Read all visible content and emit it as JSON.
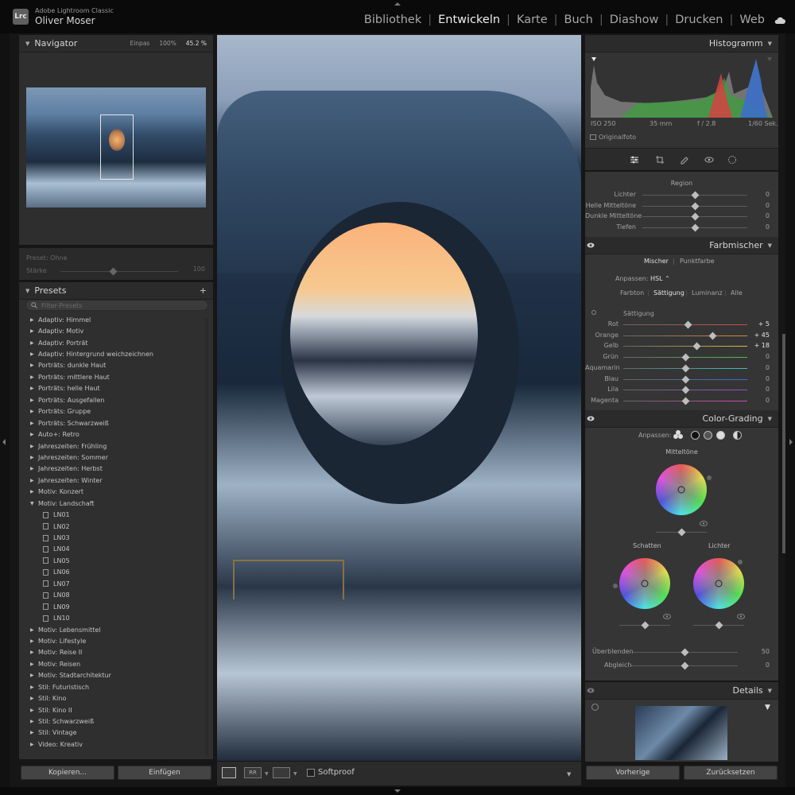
{
  "window": {
    "app_name": "Adobe Lightroom Classic",
    "user": "Oliver Moser",
    "logo": "Lrc"
  },
  "modules": [
    {
      "label": "Bibliothek",
      "active": false
    },
    {
      "label": "Entwickeln",
      "active": true
    },
    {
      "label": "Karte",
      "active": false
    },
    {
      "label": "Buch",
      "active": false
    },
    {
      "label": "Diashow",
      "active": false
    },
    {
      "label": "Drucken",
      "active": false
    },
    {
      "label": "Web",
      "active": false
    }
  ],
  "navigator": {
    "title": "Navigator",
    "opt_fit": "Einpas",
    "opt_100": "100%",
    "opt_zoom": "45.2 %"
  },
  "preset_amount": {
    "preset_label": "Preset: Ohne",
    "amount_label": "Stärke",
    "amount_value": "100"
  },
  "presets": {
    "title": "Presets",
    "filter_placeholder": "Filter-Presets",
    "groups": [
      "Adaptiv: Himmel",
      "Adaptiv: Motiv",
      "Adaptiv: Porträt",
      "Adaptiv: Hintergrund weichzeichnen",
      "Porträts: dunkle Haut",
      "Porträts: mittlere Haut",
      "Porträts: helle Haut",
      "Porträts: Ausgefallen",
      "Porträts: Gruppe",
      "Porträts: Schwarzweiß",
      "Auto+: Retro",
      "Jahreszeiten: Frühling",
      "Jahreszeiten: Sommer",
      "Jahreszeiten: Herbst",
      "Jahreszeiten: Winter",
      "Motiv: Konzert",
      "Motiv: Landschaft"
    ],
    "expanded_items": [
      "LN01",
      "LN02",
      "LN03",
      "LN04",
      "LN05",
      "LN06",
      "LN07",
      "LN08",
      "LN09",
      "LN10"
    ],
    "groups_after": [
      "Motiv: Lebensmittel",
      "Motiv: Lifestyle",
      "Motiv: Reise II",
      "Motiv: Reisen",
      "Motiv: Stadtarchitektur",
      "Stil: Futuristisch",
      "Stil: Kino",
      "Stil: Kino II",
      "Stil: Schwarzweiß",
      "Stil: Vintage",
      "Video: Kreativ"
    ]
  },
  "left_buttons": {
    "copy": "Kopieren...",
    "paste": "Einfügen"
  },
  "toolbar": {
    "softproof": "Softproof"
  },
  "histogram": {
    "title": "Histogramm",
    "iso": "ISO 250",
    "focal": "35 mm",
    "aperture": "f / 2.8",
    "shutter": "1/60 Sek.",
    "original_photo": "Originalfoto"
  },
  "region": {
    "title": "Region",
    "rows": [
      {
        "label": "Lichter",
        "value": "0",
        "pos": 0.5
      },
      {
        "label": "Helle Mitteltöne",
        "value": "0",
        "pos": 0.5
      },
      {
        "label": "Dunkle Mitteltöne",
        "value": "0",
        "pos": 0.5
      },
      {
        "label": "Tiefen",
        "value": "0",
        "pos": 0.5
      }
    ]
  },
  "mixer": {
    "title": "Farbmischer",
    "tab1": "Mischer",
    "tab2": "Punktfarbe",
    "adjust_label": "Anpassen:",
    "adjust_value": "HSL",
    "modes": [
      "Farbton",
      "Sättigung",
      "Luminanz",
      "Alle"
    ],
    "active_mode": "Sättigung",
    "section": "Sättigung",
    "rows": [
      {
        "label": "Rot",
        "value": "+ 5",
        "pos": 0.52,
        "color": "#d24a4a"
      },
      {
        "label": "Orange",
        "value": "+ 45",
        "pos": 0.72,
        "color": "#d88b3a"
      },
      {
        "label": "Gelb",
        "value": "+ 18",
        "pos": 0.59,
        "color": "#d3c23a"
      },
      {
        "label": "Grün",
        "value": "0",
        "pos": 0.5,
        "color": "#4cc24c"
      },
      {
        "label": "Aquamarin",
        "value": "0",
        "pos": 0.5,
        "color": "#3ac4b8"
      },
      {
        "label": "Blau",
        "value": "0",
        "pos": 0.5,
        "color": "#3a68d2"
      },
      {
        "label": "Lila",
        "value": "0",
        "pos": 0.5,
        "color": "#9c4ad2"
      },
      {
        "label": "Magenta",
        "value": "0",
        "pos": 0.5,
        "color": "#d24ab0"
      }
    ]
  },
  "grading": {
    "title": "Color-Grading",
    "adjust_label": "Anpassen:",
    "midtones": "Mitteltöne",
    "shadows": "Schatten",
    "highlights": "Lichter",
    "blend_label": "Überblenden",
    "blend_value": "50",
    "blend_pos": 0.5,
    "balance_label": "Abgleich",
    "balance_value": "0",
    "balance_pos": 0.5
  },
  "details": {
    "title": "Details"
  },
  "right_buttons": {
    "previous": "Vorherige",
    "reset": "Zurücksetzen"
  },
  "colors": {
    "accent": "#d6d6d6",
    "panel": "#333333",
    "header": "#2b2b2b"
  }
}
